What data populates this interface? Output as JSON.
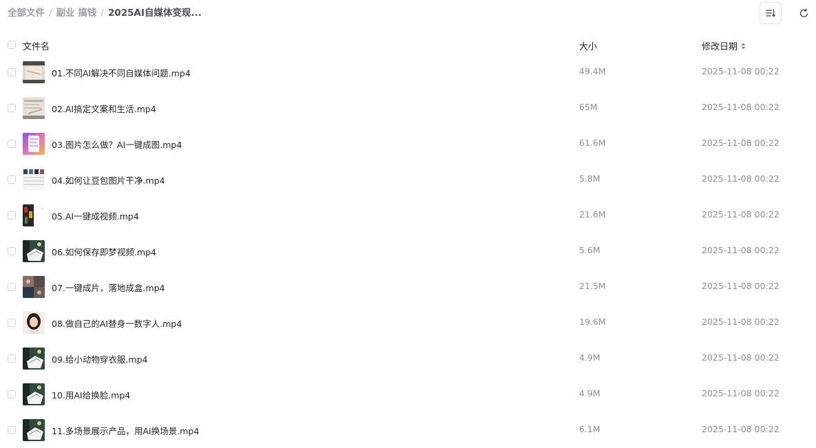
{
  "breadcrumb": {
    "items": [
      "全部文件",
      "副业 搞钱",
      "2025AI自媒体变现..."
    ],
    "separator": "/"
  },
  "toolbar": {
    "sort_icon": "sort-list-icon",
    "refresh_icon": "refresh-icon"
  },
  "table": {
    "headers": {
      "name": "文件名",
      "size": "大小",
      "date": "修改日期"
    },
    "rows": [
      {
        "name": "01.不同AI解决不同自媒体问题.mp4",
        "size": "49.4M",
        "date": "2025-11-08 00:22"
      },
      {
        "name": "02.AI搞定文案和生活.mp4",
        "size": "65M",
        "date": "2025-11-08 00:22"
      },
      {
        "name": "03.图片怎么做？AI一键成图.mp4",
        "size": "61.6M",
        "date": "2025-11-08 00:22"
      },
      {
        "name": "04.如何让豆包图片干净.mp4",
        "size": "5.8M",
        "date": "2025-11-08 00:22"
      },
      {
        "name": "05.AI一键成视频.mp4",
        "size": "21.6M",
        "date": "2025-11-08 00:22"
      },
      {
        "name": "06.如何保存即梦视频.mp4",
        "size": "5.6M",
        "date": "2025-11-08 00:22"
      },
      {
        "name": "07.一键成片，落地成盒.mp4",
        "size": "21.5M",
        "date": "2025-11-08 00:22"
      },
      {
        "name": "08.做自己的AI替身一数字人.mp4",
        "size": "19.6M",
        "date": "2025-11-08 00:22"
      },
      {
        "name": "09.给小动物穿衣服.mp4",
        "size": "4.9M",
        "date": "2025-11-08 00:22"
      },
      {
        "name": "10.用AI给换脸.mp4",
        "size": "4.9M",
        "date": "2025-11-08 00:22"
      },
      {
        "name": "11.多场景展示产品，用AI换场景.mp4",
        "size": "6.1M",
        "date": "2025-11-08 00:22"
      }
    ]
  }
}
